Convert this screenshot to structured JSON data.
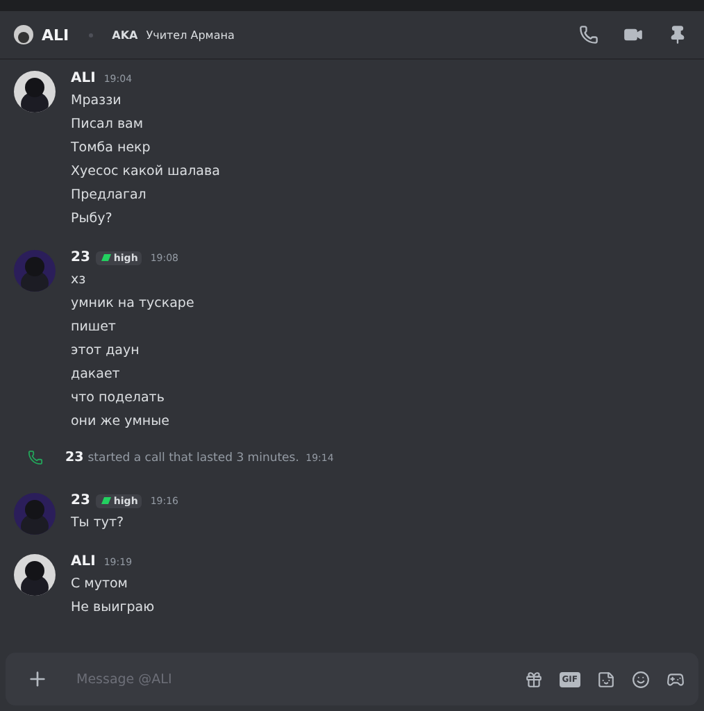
{
  "header": {
    "name": "ALI",
    "aka_label": "AKA",
    "aka": "Учител Армана"
  },
  "messages": [
    {
      "kind": "group",
      "color": "#d8d8d8",
      "author": "ALI",
      "time": "19:04",
      "lines": [
        "Мраззи",
        "Писал вам",
        "Томба некр",
        "Хуесос какой шалава",
        "Предлагал",
        "Рыбу?"
      ]
    },
    {
      "kind": "group",
      "color": "#2b1e5a",
      "author": "23",
      "badge": "high",
      "time": "19:08",
      "lines": [
        "хз",
        "умник на тускаре",
        "пишет",
        "этот даун",
        "дакает",
        "что поделать",
        "они же умные"
      ]
    },
    {
      "kind": "call",
      "author": "23",
      "text": "started a call that lasted 3 minutes.",
      "time": "19:14"
    },
    {
      "kind": "group",
      "color": "#2b1e5a",
      "author": "23",
      "badge": "high",
      "time": "19:16",
      "lines": [
        "Ты тут?"
      ]
    },
    {
      "kind": "group",
      "color": "#d8d8d8",
      "author": "ALI",
      "time": "19:19",
      "lines": [
        "С мутом",
        "Не выиграю"
      ]
    }
  ],
  "composer": {
    "placeholder": "Message @ALI",
    "gif": "GIF"
  }
}
